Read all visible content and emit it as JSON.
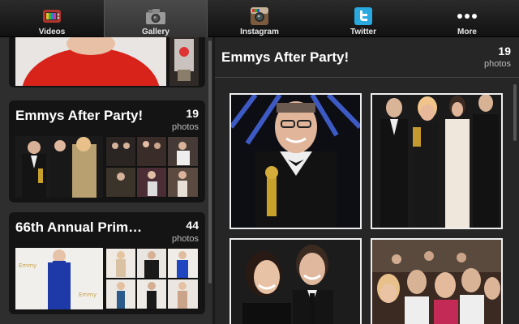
{
  "tabs": [
    {
      "label": "Videos",
      "icon": "videos-icon"
    },
    {
      "label": "Gallery",
      "icon": "camera-icon",
      "active": true
    },
    {
      "label": "Instagram",
      "icon": "instagram-icon"
    },
    {
      "label": "Twitter",
      "icon": "twitter-icon"
    },
    {
      "label": "More",
      "icon": "more-dots-icon"
    }
  ],
  "albums": [
    {
      "title": "Emmys After Party!",
      "count": "19",
      "count_label": "photos"
    },
    {
      "title": "66th Annual Prim…",
      "count": "44",
      "count_label": "photos"
    }
  ],
  "detail": {
    "title": "Emmys After Party!",
    "count": "19",
    "count_label": "photos"
  },
  "colors": {
    "accent_red": "#d61f1f",
    "twitter_blue": "#2aa9e0",
    "panel": "#2e2e2e"
  }
}
